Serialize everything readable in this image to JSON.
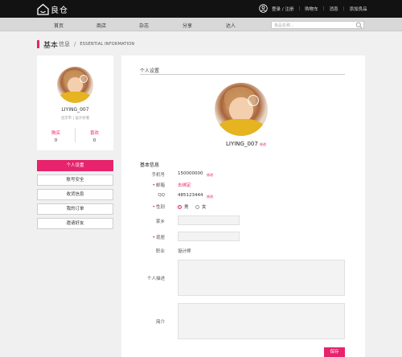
{
  "header": {
    "brand": "良仓",
    "links": [
      "登录 / 注册",
      "购物车",
      "消息",
      "添加良品"
    ]
  },
  "nav": {
    "items": [
      "首页",
      "商店",
      "杂志",
      "分享",
      "达人"
    ],
    "search_placeholder": "良品名称..."
  },
  "breadcrumb": {
    "main": "基本",
    "sub": "信息",
    "separator": "/",
    "en": "ESSENTIAL INFORMATION"
  },
  "profile": {
    "name": "LIYING_007",
    "location": "北京市 | 设计好者",
    "stats": [
      {
        "label": "购买",
        "value": "0"
      },
      {
        "label": "喜欢",
        "value": "0"
      }
    ]
  },
  "menu": {
    "items": [
      "个人设置",
      "账号安全",
      "收货信息",
      "我的订单",
      "邀请好友"
    ],
    "active_index": 0
  },
  "settings": {
    "title": "个人设置",
    "name": "LIYING_007",
    "name_edit": "修改",
    "section": "基本信息",
    "phone_label": "手机号",
    "phone_value": "150000000",
    "phone_badge": "修改",
    "email_label": "邮箱",
    "email_value": "去绑定",
    "qq_label": "QQ",
    "qq_value": "485123444",
    "qq_badge": "修改",
    "gender_label": "性别",
    "gender_options": [
      "男",
      "女"
    ],
    "gender_selected": "男",
    "hometown_label": "家乡",
    "location_label": "现居",
    "job_label": "职业",
    "job_value": "设计师",
    "desc_label": "个人描述",
    "intro_label": "简介",
    "save": "保存"
  },
  "colors": {
    "accent": "#e6236c",
    "topbar": "#121212",
    "navbar": "#d8d8d8"
  }
}
